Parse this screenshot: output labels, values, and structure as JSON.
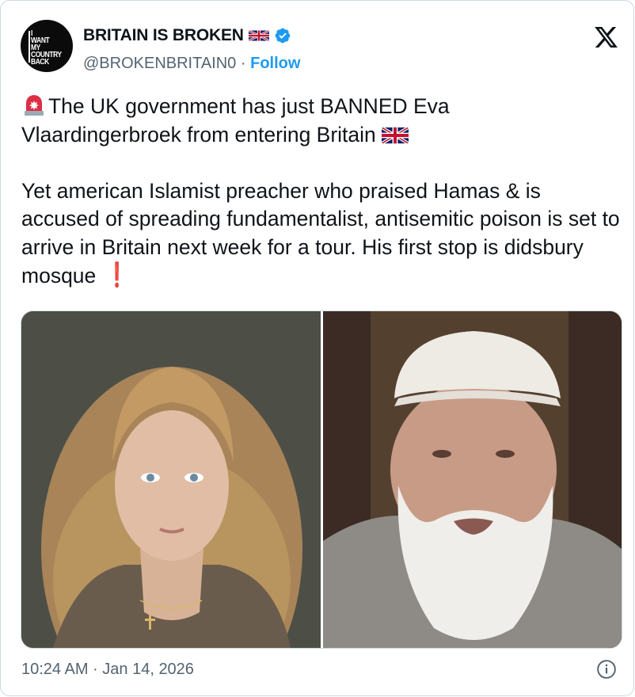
{
  "author": {
    "avatar_text": "I\nWANT\nMY\nCOUNTRY\nBACK",
    "display_name": "BRITAIN IS BROKEN",
    "handle": "@BROKENBRITAIN0",
    "separator": "·",
    "follow_label": "Follow",
    "verified": true
  },
  "tweet": {
    "line1_a": "The UK government has just BANNED Eva",
    "line1_b": "Vlaardingerbroek from entering Britain",
    "para2": "Yet american Islamist preacher who praised Hamas & is accused of spreading fundamentalist, antisemitic poison is set to arrive in Britain next week for a tour. His first stop is didsbury mosque",
    "para2_suffix": "❗"
  },
  "media": {
    "images": [
      "photo-of-young-woman-with-long-blonde-hair",
      "photo-of-bearded-man-in-white-cap"
    ]
  },
  "footer": {
    "timestamp": "10:24 AM · Jan 14, 2026"
  },
  "colors": {
    "accent": "#1d9bf0",
    "text": "#0f1419",
    "muted": "#536471",
    "border": "#cfd9de"
  },
  "icons": [
    "x-logo-icon",
    "verified-badge-icon",
    "uk-flag-icon",
    "siren-icon",
    "info-icon"
  ]
}
